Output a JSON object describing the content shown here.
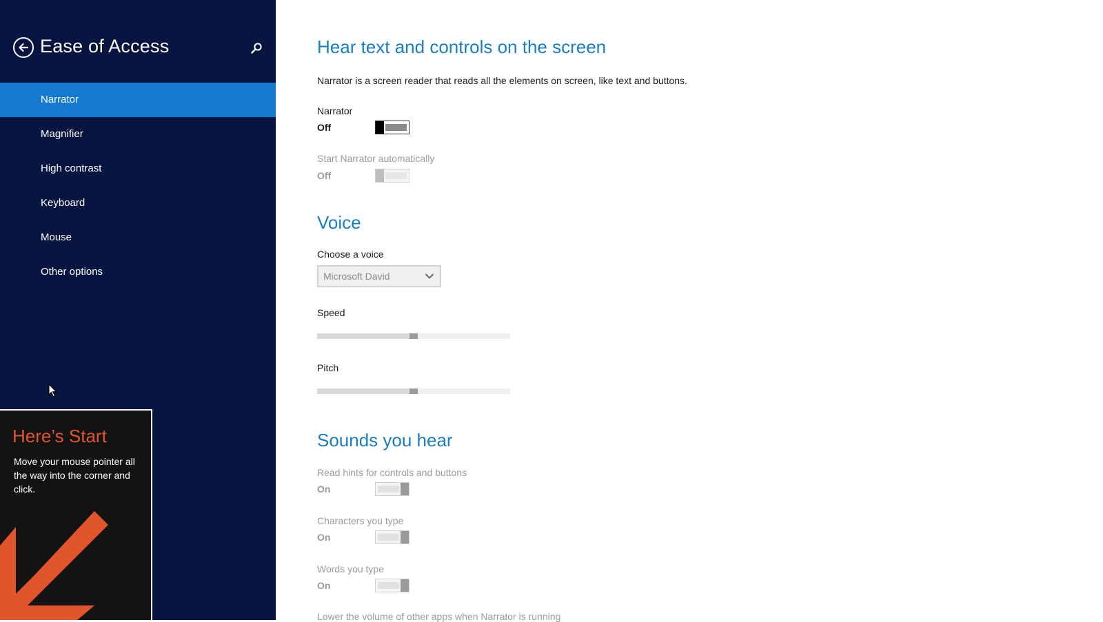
{
  "sidebar": {
    "title": "Ease of Access",
    "back_icon": "back-arrow-icon",
    "search_icon": "search-icon",
    "items": [
      {
        "label": "Narrator",
        "selected": true
      },
      {
        "label": "Magnifier"
      },
      {
        "label": "High contrast"
      },
      {
        "label": "Keyboard"
      },
      {
        "label": "Mouse"
      },
      {
        "label": "Other options"
      }
    ],
    "accent_color": "#1379d1",
    "background_color": "#071540"
  },
  "start_tip": {
    "title": "Here’s Start",
    "body": "Move your mouse pointer all the way into the corner and click.",
    "accent_color": "#e0552c"
  },
  "main": {
    "heading": "Hear text and controls on the screen",
    "description": "Narrator is a screen reader that reads all the elements on screen, like text and buttons.",
    "narrator": {
      "label": "Narrator",
      "state": "Off"
    },
    "start_auto": {
      "label": "Start Narrator automatically",
      "state": "Off"
    },
    "voice_heading": "Voice",
    "choose_voice": {
      "label": "Choose a voice",
      "value": "Microsoft David"
    },
    "speed": {
      "label": "Speed",
      "value_fraction": 0.5
    },
    "pitch": {
      "label": "Pitch",
      "value_fraction": 0.5
    },
    "sounds_heading": "Sounds you hear",
    "read_hints": {
      "label": "Read hints for controls and buttons",
      "state": "On"
    },
    "characters": {
      "label": "Characters you type",
      "state": "On"
    },
    "words": {
      "label": "Words you type",
      "state": "On"
    },
    "lower_volume": {
      "label": "Lower the volume of other apps when Narrator is running"
    },
    "heading_color": "#1a7fc1"
  }
}
